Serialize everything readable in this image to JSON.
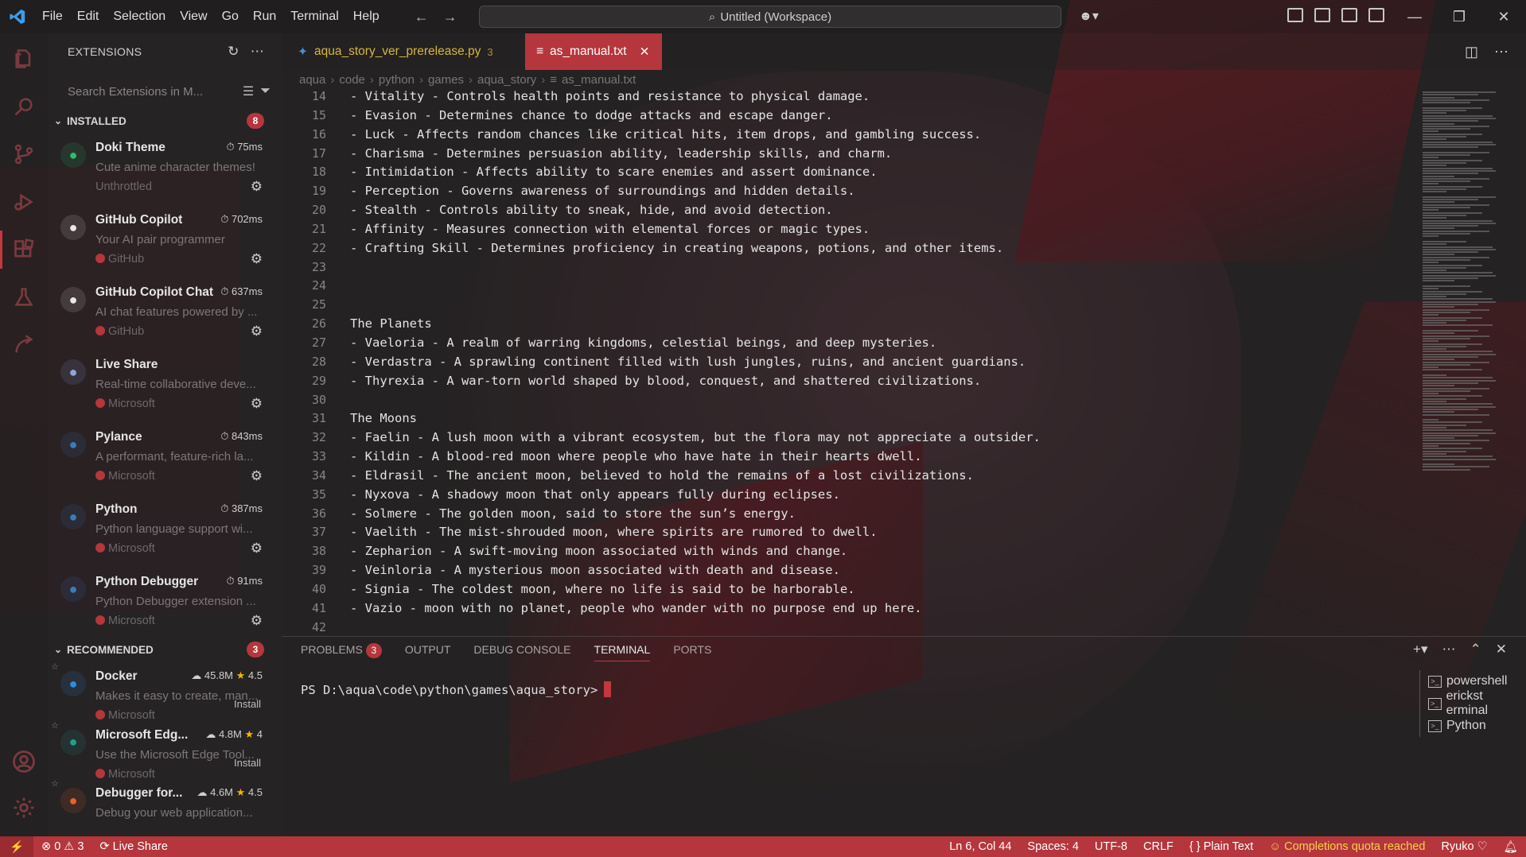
{
  "window": {
    "title": "Untitled (Workspace)"
  },
  "menu": [
    "File",
    "Edit",
    "Selection",
    "View",
    "Go",
    "Run",
    "Terminal",
    "Help"
  ],
  "sidebar": {
    "title": "EXTENSIONS",
    "search_placeholder": "Search Extensions in M...",
    "installed": {
      "label": "INSTALLED",
      "badge": "8",
      "items": [
        {
          "name": "Doki Theme",
          "meta": "75ms",
          "desc": "Cute anime character themes!",
          "pub": "Unthrottled",
          "icon": "doki-icon",
          "color": "#2dbd6e"
        },
        {
          "name": "GitHub Copilot",
          "meta": "702ms",
          "desc": "Your AI pair programmer",
          "pub": "GitHub",
          "icon": "copilot-icon",
          "color": "#e8e8e8"
        },
        {
          "name": "GitHub Copilot Chat",
          "meta": "637ms",
          "desc": "AI chat features powered by ...",
          "pub": "GitHub",
          "icon": "copilot-icon",
          "color": "#e8e8e8"
        },
        {
          "name": "Live Share",
          "meta": "",
          "desc": "Real-time collaborative deve...",
          "pub": "Microsoft",
          "icon": "live-share-icon",
          "color": "#8fa4e0"
        },
        {
          "name": "Pylance",
          "meta": "843ms",
          "desc": "A performant, feature-rich la...",
          "pub": "Microsoft",
          "icon": "python-icon",
          "color": "#3d7ab8"
        },
        {
          "name": "Python",
          "meta": "387ms",
          "desc": "Python language support wi...",
          "pub": "Microsoft",
          "icon": "python-icon",
          "color": "#3d7ab8"
        },
        {
          "name": "Python Debugger",
          "meta": "91ms",
          "desc": "Python Debugger extension ...",
          "pub": "Microsoft",
          "icon": "python-icon",
          "color": "#3d7ab8"
        }
      ]
    },
    "recommended": {
      "label": "RECOMMENDED",
      "badge": "3",
      "items": [
        {
          "name": "Docker",
          "downloads": "45.8M",
          "rating": "4.5",
          "desc": "Makes it easy to create, man...",
          "pub": "Microsoft",
          "install": "Install",
          "icon": "docker-icon",
          "color": "#2a8fe0"
        },
        {
          "name": "Microsoft Edg...",
          "downloads": "4.8M",
          "rating": "4",
          "desc": "Use the Microsoft Edge Tool...",
          "pub": "Microsoft",
          "install": "Install",
          "icon": "edge-icon",
          "color": "#1fa08f"
        },
        {
          "name": "Debugger for...",
          "downloads": "4.6M",
          "rating": "4.5",
          "desc": "Debug your web application...",
          "pub": "",
          "install": "",
          "icon": "firefox-icon",
          "color": "#e8622b"
        }
      ]
    }
  },
  "tabs": [
    {
      "label": "aqua_story_ver_prerelease.py",
      "problems": "3"
    },
    {
      "label": "as_manual.txt"
    }
  ],
  "breadcrumb": [
    "aqua",
    "code",
    "python",
    "games",
    "aqua_story",
    "as_manual.txt"
  ],
  "editor": {
    "lines": [
      {
        "n": "14",
        "t": "- Vitality - Controls health points and resistance to physical damage."
      },
      {
        "n": "15",
        "t": "- Evasion - Determines chance to dodge attacks and escape danger."
      },
      {
        "n": "16",
        "t": "- Luck - Affects random chances like critical hits, item drops, and gambling success."
      },
      {
        "n": "17",
        "t": "- Charisma - Determines persuasion ability, leadership skills, and charm."
      },
      {
        "n": "18",
        "t": "- Intimidation - Affects ability to scare enemies and assert dominance."
      },
      {
        "n": "19",
        "t": "- Perception - Governs awareness of surroundings and hidden details."
      },
      {
        "n": "20",
        "t": "- Stealth - Controls ability to sneak, hide, and avoid detection."
      },
      {
        "n": "21",
        "t": "- Affinity - Measures connection with elemental forces or magic types."
      },
      {
        "n": "22",
        "t": "- Crafting Skill - Determines proficiency in creating weapons, potions, and other items."
      },
      {
        "n": "23",
        "t": ""
      },
      {
        "n": "24",
        "t": ""
      },
      {
        "n": "25",
        "t": ""
      },
      {
        "n": "26",
        "t": "The Planets"
      },
      {
        "n": "27",
        "t": "- Vaeloria - A realm of warring kingdoms, celestial beings, and deep mysteries."
      },
      {
        "n": "28",
        "t": "- Verdastra - A sprawling continent filled with lush jungles, ruins, and ancient guardians."
      },
      {
        "n": "29",
        "t": "- Thyrexia - A war-torn world shaped by blood, conquest, and shattered civilizations."
      },
      {
        "n": "30",
        "t": ""
      },
      {
        "n": "31",
        "t": "The Moons"
      },
      {
        "n": "32",
        "t": "- Faelin - A lush moon with a vibrant ecosystem, but the flora may not appreciate a outsider."
      },
      {
        "n": "33",
        "t": "- Kildin - A blood-red moon where people who have hate in their hearts dwell."
      },
      {
        "n": "34",
        "t": "- Eldrasil - The ancient moon, believed to hold the remains of a lost civilizations."
      },
      {
        "n": "35",
        "t": "- Nyxova - A shadowy moon that only appears fully during eclipses."
      },
      {
        "n": "36",
        "t": "- Solmere - The golden moon, said to store the sun’s energy."
      },
      {
        "n": "37",
        "t": "- Vaelith - The mist-shrouded moon, where spirits are rumored to dwell."
      },
      {
        "n": "38",
        "t": "- Zepharion - A swift-moving moon associated with winds and change."
      },
      {
        "n": "39",
        "t": "- Veinloria - A mysterious moon associated with death and disease."
      },
      {
        "n": "40",
        "t": "- Signia - The coldest moon, where no life is said to be harborable."
      },
      {
        "n": "41",
        "t": "- Vazio - moon with no planet, people who wander with no purpose end up here."
      },
      {
        "n": "42",
        "t": ""
      }
    ]
  },
  "panel": {
    "tabs": [
      "PROBLEMS",
      "OUTPUT",
      "DEBUG CONSOLE",
      "TERMINAL",
      "PORTS"
    ],
    "problems_badge": "3",
    "prompt": "PS D:\\aqua\\code\\python\\games\\aqua_story>",
    "terminals": [
      "powershell",
      "erickst erminal",
      "Python"
    ]
  },
  "status": {
    "errors": "0",
    "warnings": "3",
    "live_share": "Live Share",
    "position": "Ln 6, Col 44",
    "spaces": "Spaces: 4",
    "encoding": "UTF-8",
    "eol": "CRLF",
    "language": "Plain Text",
    "copilot": "Completions quota reached",
    "theme": "Ryuko"
  },
  "colors": {
    "accent": "#b5363c",
    "status_bar": "#b5363c",
    "tab_warning": "#d7b63d"
  }
}
